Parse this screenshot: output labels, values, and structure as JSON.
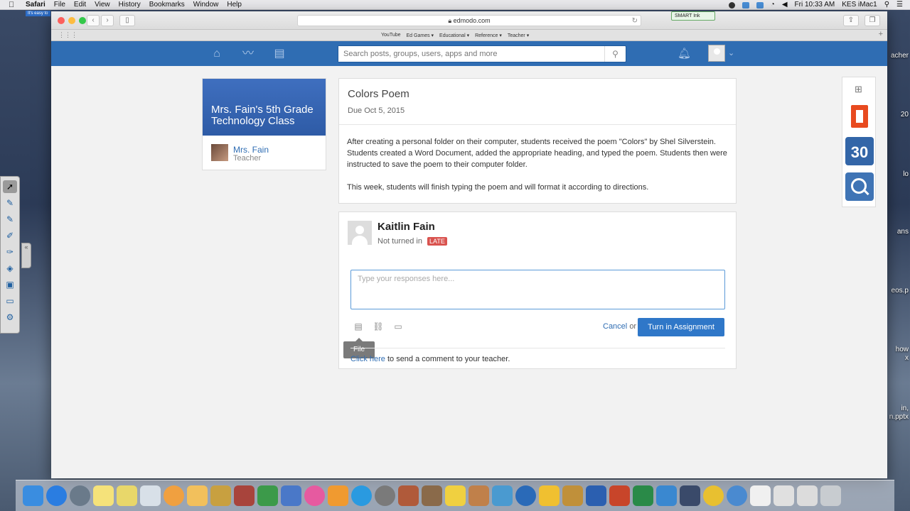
{
  "menubar": {
    "app": "Safari",
    "items": [
      "File",
      "Edit",
      "View",
      "History",
      "Bookmarks",
      "Window",
      "Help"
    ],
    "clock": "Fri 10:33 AM",
    "user": "KES iMac1"
  },
  "desktop": {
    "note": "It's easy to",
    "right_labels": [
      "acher",
      "20",
      "lo",
      "ans",
      "eos.p",
      "how",
      "x",
      "in,",
      "n.pptx"
    ]
  },
  "browser": {
    "url": "edmodo.com",
    "smart_ink": "SMART Ink",
    "bookmarks": [
      "YouTube",
      "Ed Games ▾",
      "Educational ▾",
      "Reference ▾",
      "Teacher ▾"
    ]
  },
  "nav": {
    "search_placeholder": "Search posts, groups, users, apps and more"
  },
  "group": {
    "name": "Mrs. Fain's 5th Grade Technology Class",
    "teacher_name": "Mrs. Fain",
    "teacher_role": "Teacher"
  },
  "assignment": {
    "title": "Colors Poem",
    "due": "Due Oct 5, 2015",
    "paragraph1": "After creating a personal folder on their computer, students received the poem \"Colors\" by Shel Silverstein. Students created a Word Document, added the appropriate heading, and typed the poem. Students then were instructed to save the poem to their computer folder.",
    "paragraph2": "This week, students will finish typing the poem and will format it according to directions."
  },
  "submission": {
    "student": "Kaitlin Fain",
    "status": "Not turned in",
    "late_badge": "LATE",
    "response_placeholder": "Type your responses here...",
    "tooltip": "File",
    "cancel": "Cancel",
    "or": "or",
    "turn_in": "Turn in Assignment",
    "comment_link": "Click here",
    "comment_text": " to send a comment to your teacher."
  },
  "apps": {
    "calendar_day": "30"
  },
  "colors": {
    "brand_blue": "#2f6db3",
    "late_red": "#d9534f"
  }
}
